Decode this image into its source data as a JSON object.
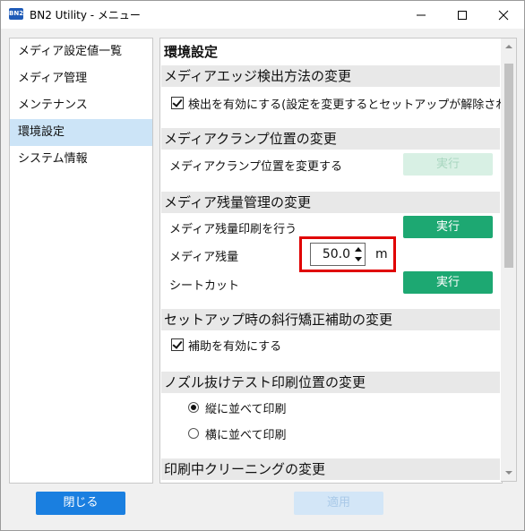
{
  "window": {
    "title": "BN2 Utility - メニュー",
    "app_icon_text": "BN2"
  },
  "sidebar": {
    "items": [
      {
        "label": "メディア設定値一覧"
      },
      {
        "label": "メディア管理"
      },
      {
        "label": "メンテナンス"
      },
      {
        "label": "環境設定",
        "selected": true
      },
      {
        "label": "システム情報"
      }
    ],
    "close_label": "閉じる"
  },
  "content": {
    "title": "環境設定",
    "sections": {
      "edge": {
        "heading": "メディアエッジ検出方法の変更",
        "checkbox_label": "検出を有効にする(設定を変更するとセットアップが解除され",
        "checked": true
      },
      "clamp": {
        "heading": "メディアクランプ位置の変更",
        "row_label": "メディアクランプ位置を変更する",
        "button_label": "実行",
        "button_enabled": false
      },
      "remaining": {
        "heading": "メディア残量管理の変更",
        "print_label": "メディア残量印刷を行う",
        "print_button": "実行",
        "amount_label": "メディア残量",
        "amount_value": "50.0",
        "amount_unit": "m",
        "cut_label": "シートカット",
        "cut_button": "実行"
      },
      "skew": {
        "heading": "セットアップ時の斜行矯正補助の変更",
        "checkbox_label": "補助を有効にする",
        "checked": true
      },
      "nozzle": {
        "heading": "ノズル抜けテスト印刷位置の変更",
        "options": [
          {
            "label": "縦に並べて印刷",
            "selected": true
          },
          {
            "label": "横に並べて印刷",
            "selected": false
          }
        ]
      },
      "cleaning": {
        "heading": "印刷中クリーニングの変更"
      }
    },
    "apply_label": "適用"
  },
  "colors": {
    "accent": "#1a7fe0",
    "run": "#1da872",
    "highlight": "#e00000",
    "selected_bg": "#cce4f7"
  }
}
